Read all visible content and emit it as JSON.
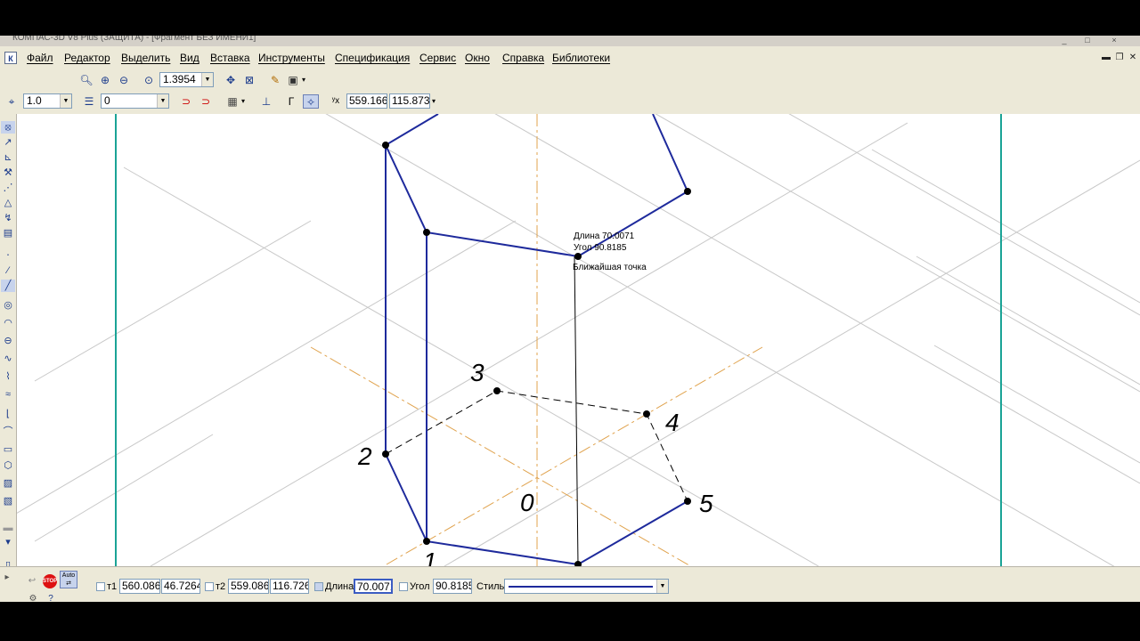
{
  "window": {
    "title": "КОМПАС-3D V8 Plus (ЗАЩИТА) - [Фрагмент БЕЗ ИМЕНИ1]",
    "minimize": "_",
    "maximize": "□",
    "close": "×"
  },
  "menu": {
    "items": [
      "Файл",
      "Редактор",
      "Выделить",
      "Вид",
      "Вставка",
      "Инструменты",
      "Спецификация",
      "Сервис",
      "Окно",
      "Справка",
      "Библиотеки"
    ],
    "doc_minimize": "▬",
    "doc_restore": "❐",
    "doc_close": "✕"
  },
  "toolbar_view": {
    "zoom_value": "1.3954"
  },
  "toolbar_current": {
    "step_value": "1.0",
    "layer_value": "0",
    "coord_x": "559.166",
    "coord_y": "115.873"
  },
  "canvas": {
    "tooltip_length": "Длина 70.0071",
    "tooltip_angle": "Угол 90.8185",
    "tooltip_snap": "Ближайшая точка",
    "point_labels": [
      "1",
      "2",
      "3",
      "4",
      "5",
      "0"
    ],
    "colors": {
      "background": "#ffffff",
      "border_line": "#1aa396",
      "axis_line": "#e0a34e",
      "construction_line": "#c0c0c0",
      "object_line": "#1e2a9c"
    }
  },
  "statusbar": {
    "p1_label": "т1",
    "p1_x": "560.0862",
    "p1_y": "46.7264",
    "p2_label": "т2",
    "p2_x": "559.0862",
    "p2_y": "116.7264",
    "length_label": "Длина",
    "length_value": "70.0071",
    "angle_label": "Угол",
    "angle_value": "90.8185",
    "style_label": "Стиль",
    "auto_label": "Auto",
    "stop_label": "STOP"
  }
}
